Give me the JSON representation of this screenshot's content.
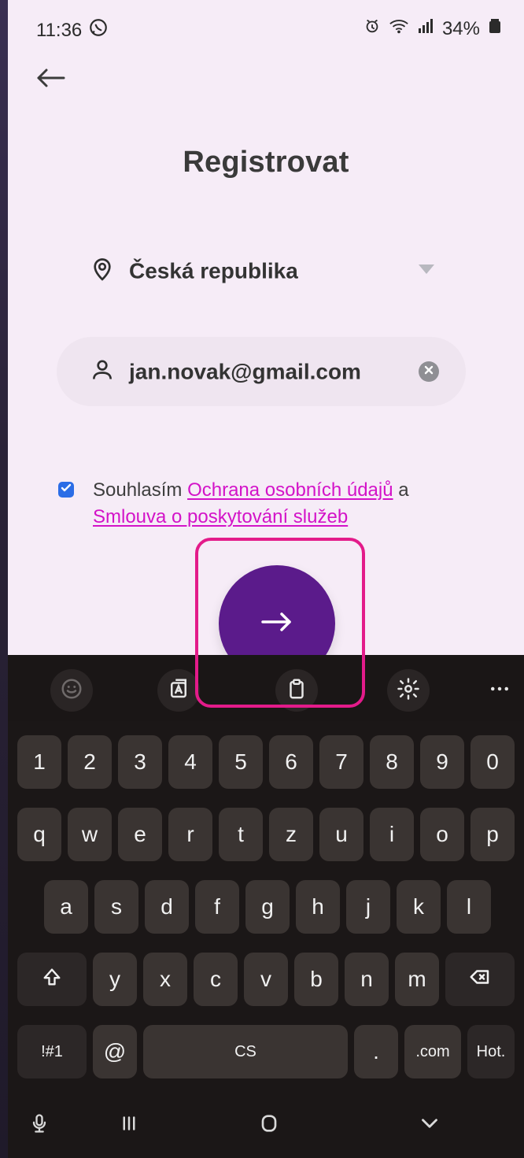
{
  "status": {
    "time": "11:36",
    "battery": "34%",
    "icons": [
      "whatsapp-icon",
      "alarm-icon",
      "wifi-icon",
      "signal-icon",
      "battery-icon"
    ]
  },
  "screen": {
    "title": "Registrovat",
    "country": {
      "label": "Česká republika"
    },
    "email": {
      "value": "jan.novak@gmail.com"
    },
    "consent": {
      "prefix": "Souhlasím ",
      "privacy_link": "Ochrana osobních údajů",
      "middle": " a",
      "terms_link": "Smlouva o poskytování služeb",
      "checked": true
    },
    "next_button": {
      "icon": "arrow-right-icon"
    }
  },
  "colors": {
    "accent": "#5b1b8b",
    "link": "#d313c8",
    "highlight": "#e31b8a",
    "checkbox": "#2b6de6",
    "background": "#f6ecf7"
  },
  "keyboard": {
    "toolbar": [
      "emoji-icon",
      "translate-icon",
      "clipboard-icon",
      "gear-icon",
      "more-icon"
    ],
    "row1": [
      "1",
      "2",
      "3",
      "4",
      "5",
      "6",
      "7",
      "8",
      "9",
      "0"
    ],
    "row2": [
      "q",
      "w",
      "e",
      "r",
      "t",
      "z",
      "u",
      "i",
      "o",
      "p"
    ],
    "row3": [
      "a",
      "s",
      "d",
      "f",
      "g",
      "h",
      "j",
      "k",
      "l"
    ],
    "row4": [
      "y",
      "x",
      "c",
      "v",
      "b",
      "n",
      "m"
    ],
    "bottom": {
      "symbols": "!#1",
      "at": "@",
      "space": "CS",
      "dot": ".",
      "com": ".com",
      "hot": "Hot."
    }
  },
  "navbar": {
    "icons": [
      "mic-icon",
      "recent-apps-icon",
      "home-icon",
      "hide-keyboard-icon"
    ]
  }
}
